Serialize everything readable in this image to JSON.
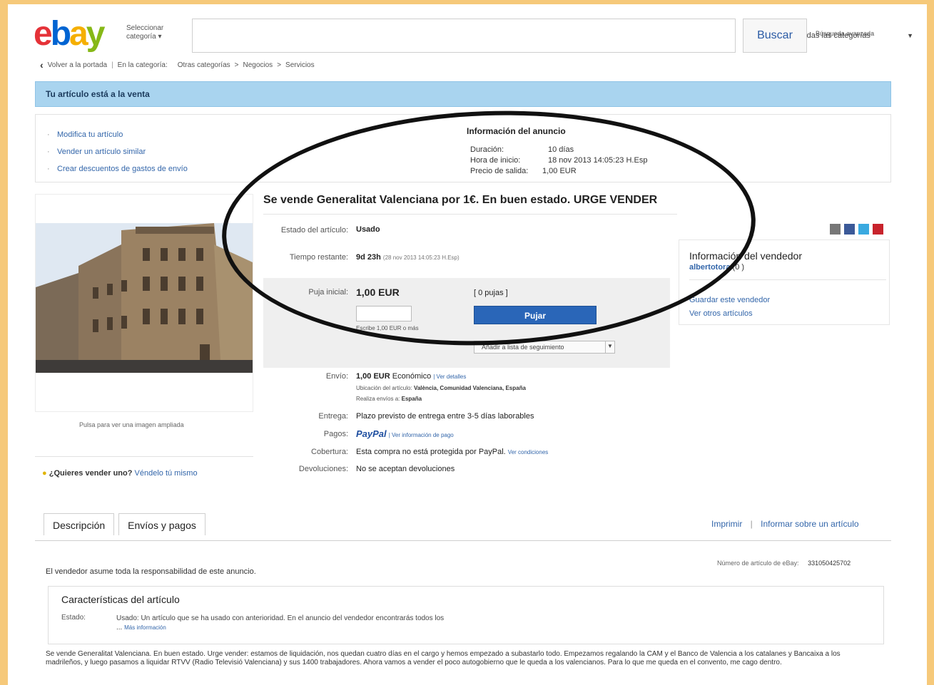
{
  "header": {
    "logo_letters": [
      {
        "ch": "e",
        "color": "#e53238"
      },
      {
        "ch": "b",
        "color": "#0064d2"
      },
      {
        "ch": "a",
        "color": "#f5af02"
      },
      {
        "ch": "y",
        "color": "#86b817"
      }
    ],
    "select_category": "Seleccionar categoría",
    "search_value": "",
    "category_dropdown": "Todas las categorías",
    "search_button": "Buscar",
    "advanced_search": "Búsqueda avanzada"
  },
  "breadcrumb": {
    "back": "Volver a la portada",
    "in_category": "En la categoría:",
    "items": [
      "Otras categorías",
      "Negocios",
      "Servicios"
    ]
  },
  "banner": "Tu artículo está a la venta",
  "actions": [
    "Modifica tu artículo",
    "Vender un artículo similar",
    "Crear descuentos de gastos de envío"
  ],
  "ad_info": {
    "title": "Información del anuncio",
    "rows": [
      {
        "label": "Duración:",
        "value": "10 días"
      },
      {
        "label": "Hora de inicio:",
        "value": "18 nov 2013 14:05:23 H.Esp"
      },
      {
        "label": "Precio de salida:",
        "value": "1,00 EUR"
      }
    ]
  },
  "image_caption": "Pulsa para ver una imagen ampliada",
  "sell_prompt": {
    "question": "¿Quieres vender uno?",
    "link": "Véndelo tú mismo"
  },
  "listing": {
    "title": "Se vende Generalitat Valenciana por 1€. En buen estado. URGE VENDER",
    "condition_label": "Estado del artículo:",
    "condition_value": "Usado",
    "time_label": "Tiempo restante:",
    "time_value": "9d 23h",
    "time_detail": "(28 nov 2013 14:05:23 H.Esp)",
    "bid_label": "Puja inicial:",
    "bid_value": "1,00 EUR",
    "bids_count": "[ 0 pujas ]",
    "bid_hint": "Escribe 1,00 EUR o más",
    "bid_button": "Pujar",
    "watchlist": "Añadir a lista de seguimiento",
    "shipping_label": "Envío:",
    "shipping_value": "1,00 EUR",
    "shipping_type": "Económico",
    "shipping_details": "| Ver detalles",
    "location_label": "Ubicación del artículo:",
    "location_value": "València, Comunidad Valenciana, España",
    "ships_to_label": "Realiza envíos a:",
    "ships_to_value": "España",
    "delivery_label": "Entrega:",
    "delivery_value": "Plazo previsto de entrega entre 3-5 días laborables",
    "payments_label": "Pagos:",
    "payments_value": "PayPal",
    "payments_link": "| Ver información de pago",
    "coverage_label": "Cobertura:",
    "coverage_value": "Esta compra no está protegida por PayPal.",
    "coverage_link": "Ver condiciones",
    "returns_label": "Devoluciones:",
    "returns_value": "No se aceptan devoluciones"
  },
  "seller": {
    "title": "Información del vendedor",
    "name": "albertotora",
    "score": "(0 )",
    "save": "Guardar este vendedor",
    "other": "Ver otros artículos"
  },
  "tabs": [
    "Descripción",
    "Envíos y pagos"
  ],
  "print": "Imprimir",
  "report": "Informar sobre un artículo",
  "item_number_label": "Número de artículo de eBay:",
  "item_number": "331050425702",
  "responsibility": "El vendedor asume toda la responsabilidad de este anuncio.",
  "features": {
    "title": "Características del artículo",
    "state_label": "Estado:",
    "state_value": "Usado: Un artículo que se ha usado con anterioridad. En el anuncio del vendedor encontrarás todos los ...",
    "more": "Más información"
  },
  "description": "Se vende Generalitat Valenciana. En buen estado. Urge vender: estamos de liquidación, nos quedan cuatro días en el cargo y hemos empezado a subastarlo todo. Empezamos regalando la CAM y el Banco de Valencia a los catalanes y Bancaixa a los madrileños, y luego pasamos a liquidar RTVV (Radio Televisió Valenciana) y sus 1400 trabajadores. Ahora vamos a vender el poco autogobierno que le queda a los valencianos. Para lo que me queda en el convento, me cago dentro."
}
